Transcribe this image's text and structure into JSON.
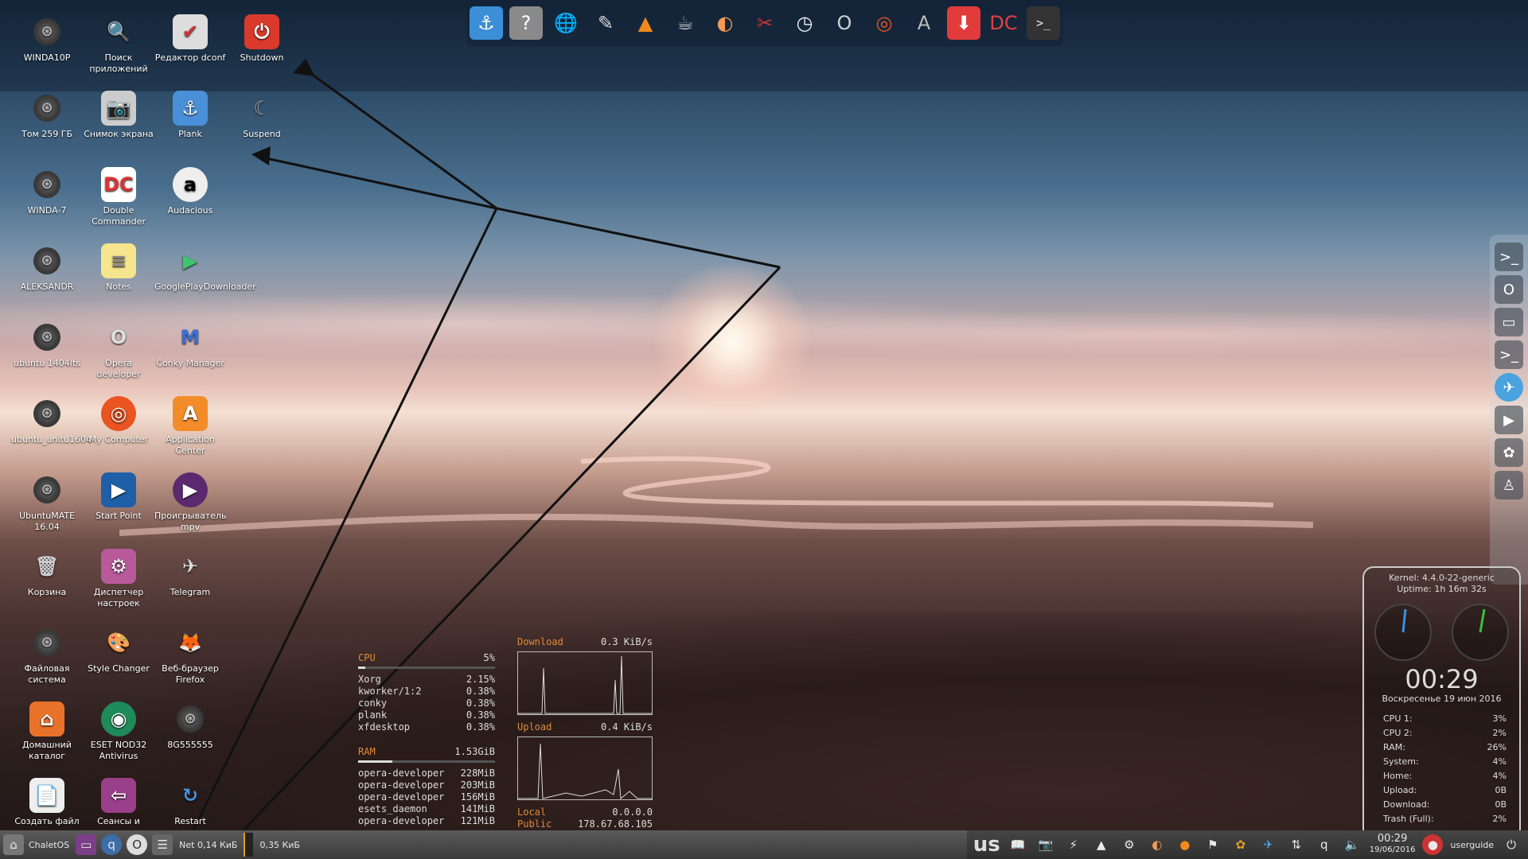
{
  "desktop_icons": [
    {
      "label": "WINDA10P",
      "icon": "disk-icon",
      "glyph": "⊛"
    },
    {
      "label": "Поиск приложений",
      "icon": "search-icon",
      "glyph": "🔍"
    },
    {
      "label": "Редактор dconf",
      "icon": "dconf-icon",
      "glyph": "✔"
    },
    {
      "label": "Shutdown",
      "icon": "power-icon",
      "glyph": "⏻"
    },
    {
      "label": "Том 259 ГБ",
      "icon": "disk-icon",
      "glyph": "⊛"
    },
    {
      "label": "Снимок экрана",
      "icon": "camera-icon",
      "glyph": "📷"
    },
    {
      "label": "Plank",
      "icon": "anchor-icon",
      "glyph": "⚓"
    },
    {
      "label": "Suspend",
      "icon": "suspend-icon",
      "glyph": "☾"
    },
    {
      "label": "WINDA-7",
      "icon": "disk-icon",
      "glyph": "⊛"
    },
    {
      "label": "Double Commander",
      "icon": "double-commander-icon",
      "glyph": "DC"
    },
    {
      "label": "Audacious",
      "icon": "audacious-icon",
      "glyph": "a"
    },
    {
      "label": "ALEKSANDR",
      "icon": "disk-icon",
      "glyph": "⊛"
    },
    {
      "label": "Notes",
      "icon": "notes-icon",
      "glyph": "≡"
    },
    {
      "label": "GooglePlayDownloader",
      "icon": "google-play-icon",
      "glyph": "▶"
    },
    {
      "label": "ubuntu 1404lts",
      "icon": "disk-icon",
      "glyph": "⊛"
    },
    {
      "label": "Opera developer",
      "icon": "opera-icon",
      "glyph": "O"
    },
    {
      "label": "Conky Manager",
      "icon": "conky-icon",
      "glyph": "M"
    },
    {
      "label": "ubuntu_unitu1604",
      "icon": "disk-icon",
      "glyph": "⊛"
    },
    {
      "label": "My Computer",
      "icon": "ubuntu-icon",
      "glyph": "◎"
    },
    {
      "label": "Application Center",
      "icon": "app-center-icon",
      "glyph": "A"
    },
    {
      "label": "UbuntuMATE 16.04",
      "icon": "disk-icon",
      "glyph": "⊛"
    },
    {
      "label": "Start Point",
      "icon": "start-point-icon",
      "glyph": "▶"
    },
    {
      "label": "Проигрыватель mpv",
      "icon": "mpv-icon",
      "glyph": "▶"
    },
    {
      "label": "Корзина",
      "icon": "trash-icon",
      "glyph": "🗑"
    },
    {
      "label": "Диспетчер настроек",
      "icon": "settings-manager-icon",
      "glyph": "⚙"
    },
    {
      "label": "Telegram",
      "icon": "telegram-icon",
      "glyph": "✈"
    },
    {
      "label": "Файловая система",
      "icon": "disk-icon",
      "glyph": "⊛"
    },
    {
      "label": "Style Changer",
      "icon": "style-changer-icon",
      "glyph": "🎨"
    },
    {
      "label": "Веб-браузер Firefox",
      "icon": "firefox-icon",
      "glyph": "🦊"
    },
    {
      "label": "Домашний каталог",
      "icon": "home-folder-icon",
      "glyph": "⌂"
    },
    {
      "label": "ESET NOD32 Antivirus",
      "icon": "eset-icon",
      "glyph": "◉"
    },
    {
      "label": "8G555555",
      "icon": "disk-icon",
      "glyph": "⊛"
    },
    {
      "label": "Создать файл",
      "icon": "new-file-icon",
      "glyph": "📄"
    },
    {
      "label": "Сеансы и",
      "icon": "sessions-icon",
      "glyph": "⇦"
    },
    {
      "label": "Restart",
      "icon": "restart-icon",
      "glyph": "↻"
    }
  ],
  "dock_items": [
    {
      "name": "plank",
      "glyph": "⚓",
      "color": "#3c8fd6"
    },
    {
      "name": "help",
      "glyph": "?",
      "color": "#8a8a8a"
    },
    {
      "name": "globe",
      "glyph": "🌐",
      "color": "#2a6aa8"
    },
    {
      "name": "text-editor",
      "glyph": "✎",
      "color": "#d8d8d8"
    },
    {
      "name": "vlc",
      "glyph": "▲",
      "color": "#f08a1c"
    },
    {
      "name": "coffee",
      "glyph": "☕",
      "color": "#cfcfcf"
    },
    {
      "name": "slice",
      "glyph": "◐",
      "color": "#f49a55"
    },
    {
      "name": "scissors",
      "glyph": "✂",
      "color": "#cc3333"
    },
    {
      "name": "clock",
      "glyph": "◷",
      "color": "#eeeeee"
    },
    {
      "name": "opera",
      "glyph": "O",
      "color": "#d0d0d0"
    },
    {
      "name": "ubuntu",
      "glyph": "◎",
      "color": "#e95420"
    },
    {
      "name": "software-updater",
      "glyph": "A",
      "color": "#bbbbbb"
    },
    {
      "name": "download",
      "glyph": "⬇",
      "color": "#e23b3b"
    },
    {
      "name": "double-commander",
      "glyph": "DC",
      "color": "#e04040"
    },
    {
      "name": "terminal",
      "glyph": ">_",
      "color": "#333333"
    }
  ],
  "side_dock_items": [
    {
      "name": "terminal",
      "glyph": ">_"
    },
    {
      "name": "opera",
      "glyph": "O"
    },
    {
      "name": "folder",
      "glyph": "▭"
    },
    {
      "name": "terminal-2",
      "glyph": ">_"
    },
    {
      "name": "telegram",
      "glyph": "✈"
    },
    {
      "name": "google-play",
      "glyph": "▶"
    },
    {
      "name": "pidgin",
      "glyph": "✿"
    },
    {
      "name": "user",
      "glyph": "♙"
    }
  ],
  "conky_left": {
    "cpu_label": "CPU",
    "cpu_value": "5%",
    "cpu_fraction": 0.05,
    "processes": [
      {
        "name": "Xorg",
        "value": "2.15%"
      },
      {
        "name": "kworker/1:2",
        "value": "0.38%"
      },
      {
        "name": "conky",
        "value": "0.38%"
      },
      {
        "name": "plank",
        "value": "0.38%"
      },
      {
        "name": "xfdesktop",
        "value": "0.38%"
      }
    ],
    "ram_label": "RAM",
    "ram_value": "1.53GiB",
    "ram_fraction": 0.25,
    "memory": [
      {
        "name": "opera-developer",
        "value": "228MiB"
      },
      {
        "name": "opera-developer",
        "value": "203MiB"
      },
      {
        "name": "opera-developer",
        "value": "156MiB"
      },
      {
        "name": "esets_daemon",
        "value": "141MiB"
      },
      {
        "name": "opera-developer",
        "value": "121MiB"
      }
    ]
  },
  "conky_net": {
    "download_label": "Download",
    "download_value": "0.3 KiB/s",
    "upload_label": "Upload",
    "upload_value": "0.4 KiB/s",
    "local_label": "Local",
    "local_value": "0.0.0.0",
    "public_label": "Public",
    "public_value": "178.67.68.105"
  },
  "sysinfo": {
    "kernel": "Kernel: 4.4.0-22-generic",
    "uptime": "Uptime: 1h 16m 32s",
    "time": "00:29",
    "date": "Воскресенье 19 июн 2016",
    "stats": [
      {
        "label": "CPU 1:",
        "value": "3%"
      },
      {
        "label": "CPU 2:",
        "value": "2%"
      },
      {
        "label": "RAM:",
        "value": "26%"
      },
      {
        "label": "System:",
        "value": "4%"
      },
      {
        "label": "Home:",
        "value": "4%"
      },
      {
        "label": "Upload:",
        "value": "0B"
      },
      {
        "label": "Download:",
        "value": "0B"
      },
      {
        "label": "Trash (Full):",
        "value": "2%"
      }
    ]
  },
  "panel": {
    "menu_label": "ChaletOS",
    "net_text": "Net 0,14 КиБ",
    "net_text2": "0,35 КиБ",
    "layout": "us",
    "clock_time": "00:29",
    "clock_date": "19/06/2016",
    "user": "userguide"
  }
}
